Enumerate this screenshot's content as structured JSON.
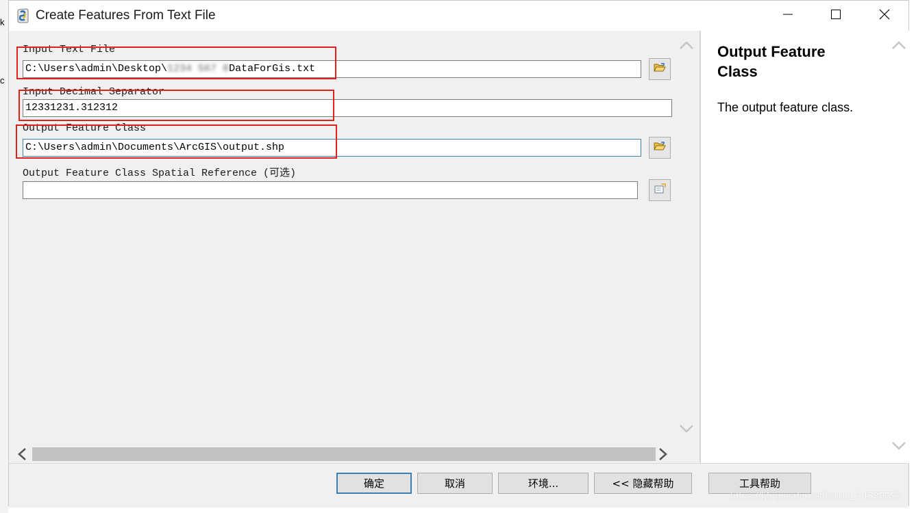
{
  "window": {
    "title": "Create Features From Text File",
    "icon": "python-script-icon"
  },
  "edge_glyphs": [
    "k",
    "c"
  ],
  "fields": [
    {
      "label": "Input Text File",
      "value_prefix": "C:\\Users\\admin\\Desktop\\",
      "value_blurred": "1234 567 8",
      "value_suffix": "DataForGis.txt",
      "browse_icon": "open-folder-icon"
    },
    {
      "label": "Input Decimal Separator",
      "value": "12331231.312312"
    },
    {
      "label": "Output Feature Class",
      "value": "C:\\Users\\admin\\Documents\\ArcGIS\\output.shp",
      "browse_icon": "open-folder-icon"
    },
    {
      "label": "Output Feature Class Spatial Reference (可选)",
      "value": "",
      "browse_icon": "properties-icon"
    }
  ],
  "help": {
    "title": "Output Feature Class",
    "body": "The output feature class."
  },
  "buttons": {
    "ok": "确定",
    "cancel": "取消",
    "environments": "环境...",
    "hide_help": "<< 隐藏帮助",
    "tool_help": "工具帮助"
  },
  "watermark": "https://blog.csdn.net/baidu_34785556",
  "colors": {
    "highlight": "#e0201c",
    "focus_border": "#3c7fb1",
    "background": "#f0f0f0"
  }
}
